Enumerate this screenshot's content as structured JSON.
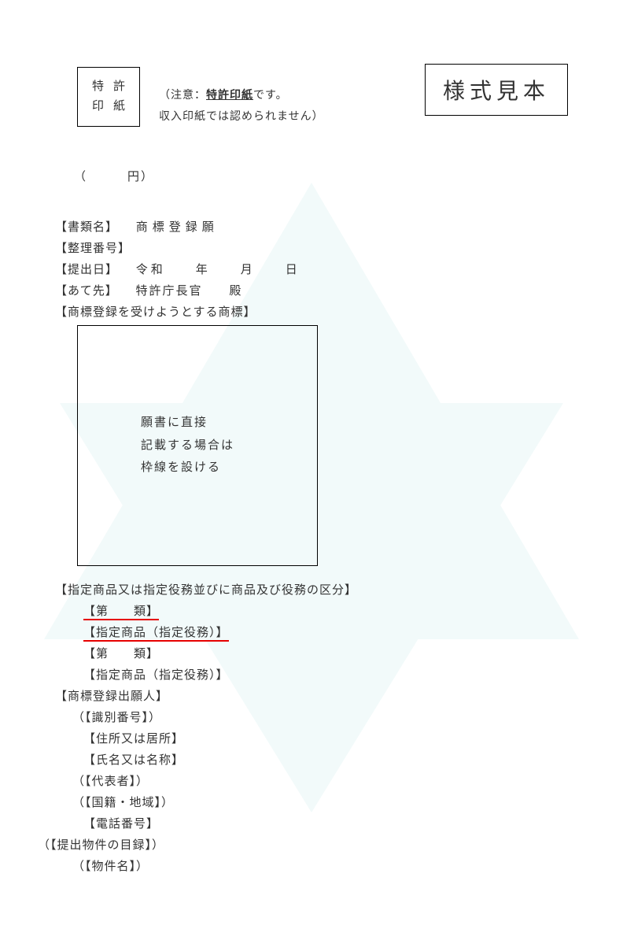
{
  "sample_label": "様式見本",
  "stamp": {
    "line1": "特許",
    "line2": "印紙"
  },
  "notice": {
    "prefix": "（注意：",
    "bold": "特許印紙",
    "mid": "です。",
    "line2": "収入印紙では認められません）"
  },
  "yen": "（　　　円）",
  "fields": {
    "doc_name_label": "【書類名】",
    "doc_name_value": "商標登録願",
    "ref_no_label": "【整理番号】",
    "submit_date_label": "【提出日】",
    "submit_date_value": "令和　　年　　月　　日",
    "dest_label": "【あて先】",
    "dest_value": "特許庁長官　　殿",
    "tm_label": "【商標登録を受けようとする商標】"
  },
  "tm_box": {
    "l1": "願書に直接",
    "l2": "記載する場合は",
    "l3": "枠線を設ける"
  },
  "designated": {
    "header": "【指定商品又は指定役務並びに商品及び役務の区分】",
    "class_row": "【第　　類】",
    "goods_row": "【指定商品（指定役務）】",
    "class_row2": "【第　　類】",
    "goods_row2": "【指定商品（指定役務）】"
  },
  "applicant": {
    "header": "【商標登録出願人】",
    "id_no": "（【識別番号】）",
    "address": "【住所又は居所】",
    "name": "【氏名又は名称】",
    "rep": "（【代表者】）",
    "nat": "（【国籍・地域】）",
    "tel": "【電話番号】"
  },
  "attachments": {
    "header": "（【提出物件の目録】）",
    "item": "（【物件名】）"
  }
}
